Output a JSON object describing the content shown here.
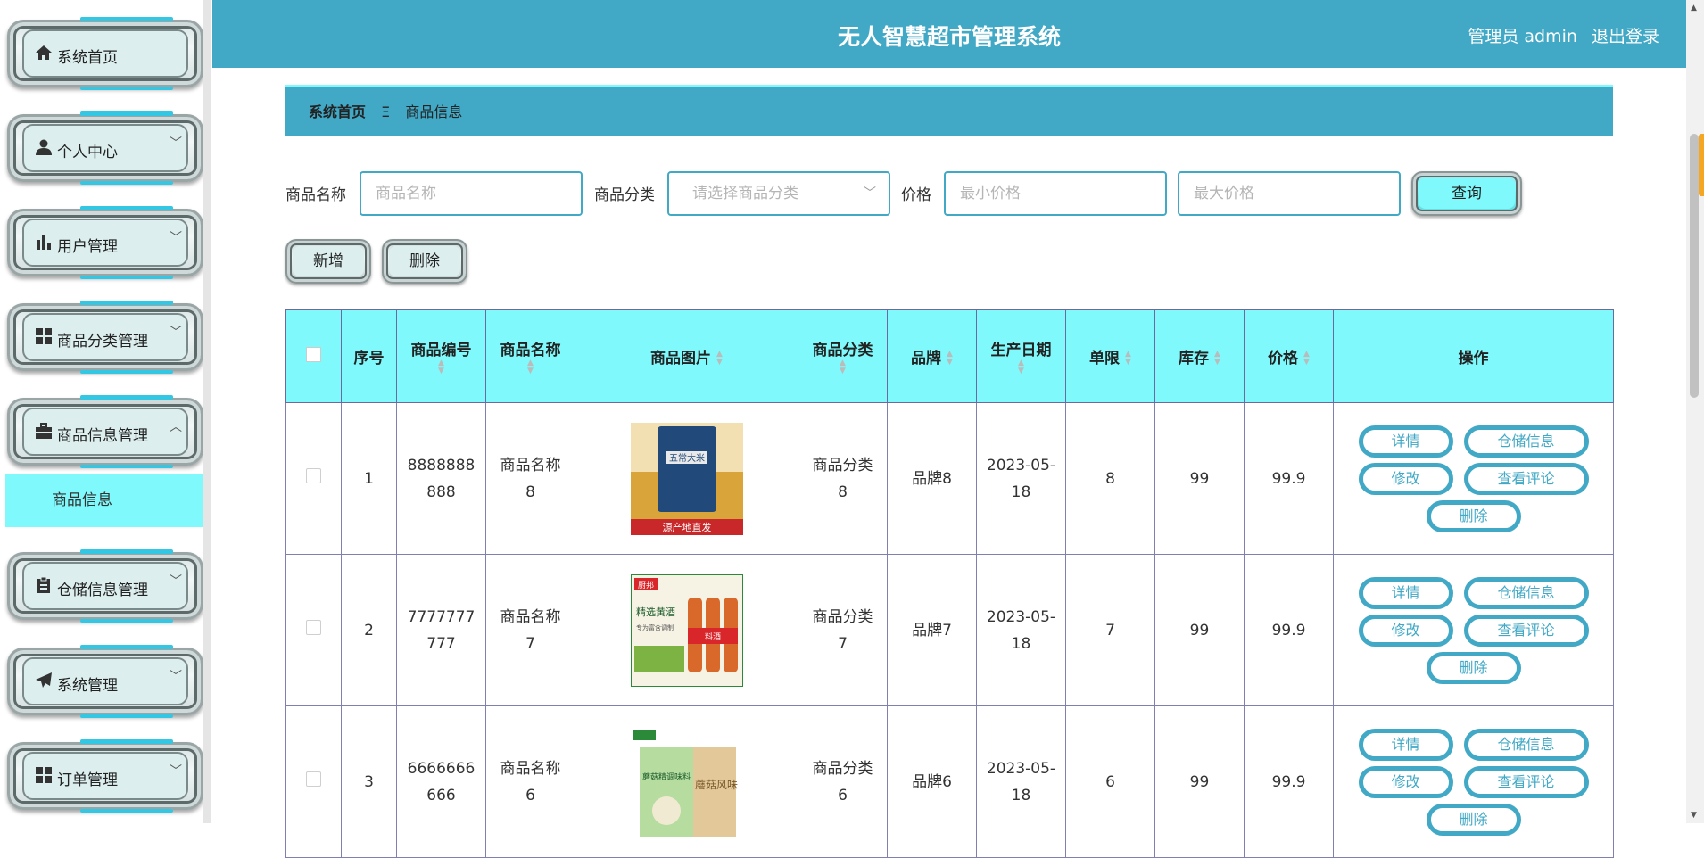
{
  "header": {
    "title": "无人智慧超市管理系统",
    "user": "管理员 admin",
    "logout": "退出登录"
  },
  "sidebar": {
    "items": [
      {
        "label": "系统首页",
        "icon": "home-icon"
      },
      {
        "label": "个人中心",
        "icon": "user-icon"
      },
      {
        "label": "用户管理",
        "icon": "bar-chart-icon"
      },
      {
        "label": "商品分类管理",
        "icon": "grid-icon"
      },
      {
        "label": "商品信息管理",
        "icon": "briefcase-icon"
      },
      {
        "label": "仓储信息管理",
        "icon": "clipboard-icon"
      },
      {
        "label": "系统管理",
        "icon": "paper-plane-icon"
      },
      {
        "label": "订单管理",
        "icon": "grid-icon"
      }
    ],
    "active_sub": "商品信息"
  },
  "breadcrumb": {
    "home": "系统首页",
    "sep": "Ξ",
    "current": "商品信息"
  },
  "search": {
    "name_label": "商品名称",
    "name_placeholder": "商品名称",
    "category_label": "商品分类",
    "category_placeholder": "请选择商品分类",
    "price_label": "价格",
    "min_placeholder": "最小价格",
    "max_placeholder": "最大价格",
    "query_button": "查询"
  },
  "actions": {
    "add": "新增",
    "delete": "删除"
  },
  "table": {
    "headers": {
      "index": "序号",
      "code": "商品编号",
      "name": "商品名称",
      "image": "商品图片",
      "category": "商品分类",
      "brand": "品牌",
      "date": "生产日期",
      "limit": "单限",
      "stock": "库存",
      "price": "价格",
      "ops": "操作"
    },
    "op_labels": {
      "detail": "详情",
      "storage": "仓储信息",
      "edit": "修改",
      "reviews": "查看评论",
      "delete": "删除"
    },
    "rows": [
      {
        "index": "1",
        "code1": "8888888",
        "code2": "888",
        "name1": "商品名称",
        "name2": "8",
        "cat1": "商品分类",
        "cat2": "8",
        "brand": "品牌8",
        "date1": "2023-05-",
        "date2": "18",
        "limit": "8",
        "stock": "99",
        "price": "99.9"
      },
      {
        "index": "2",
        "code1": "7777777",
        "code2": "777",
        "name1": "商品名称",
        "name2": "7",
        "cat1": "商品分类",
        "cat2": "7",
        "brand": "品牌7",
        "date1": "2023-05-",
        "date2": "18",
        "limit": "7",
        "stock": "99",
        "price": "99.9"
      },
      {
        "index": "3",
        "code1": "6666666",
        "code2": "666",
        "name1": "商品名称",
        "name2": "6",
        "cat1": "商品分类",
        "cat2": "6",
        "brand": "品牌6",
        "date1": "2023-05-",
        "date2": "18",
        "limit": "6",
        "stock": "99",
        "price": "99.9"
      }
    ],
    "images": {
      "row1_text": "五常大米",
      "row1_band": "源产地直发",
      "row2_brand": "厨邦",
      "row2_text": "精选黄酒",
      "row2_sub": "专为富含调制",
      "row2_bottle": "料酒",
      "row3_text": "蘑菇风味",
      "row3_sub": "蘑菇精调味料"
    }
  }
}
